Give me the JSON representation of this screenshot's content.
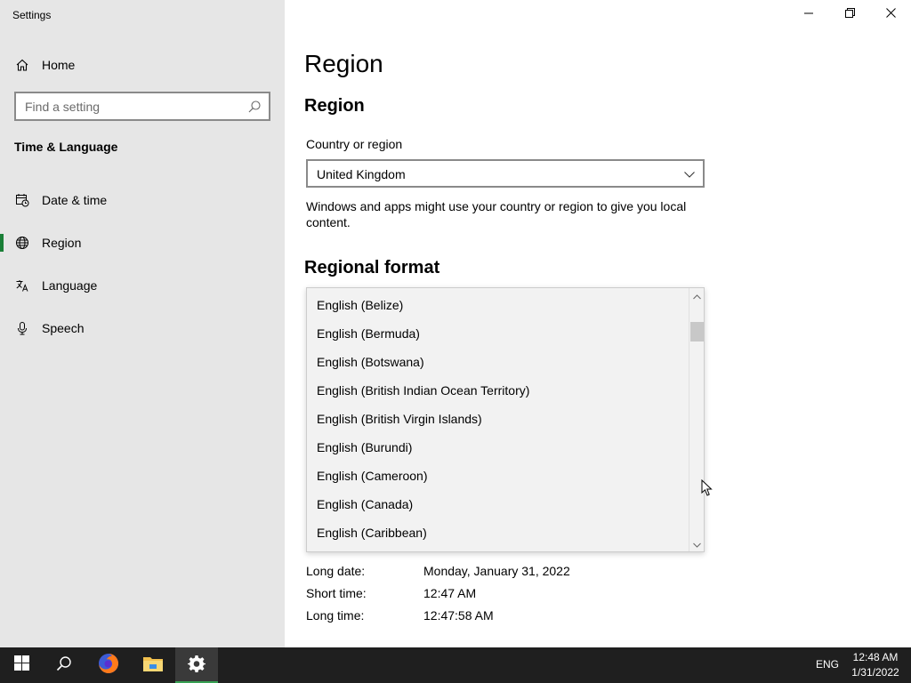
{
  "window": {
    "title": "Settings",
    "minimize_icon": "minimize-icon",
    "restore_icon": "restore-icon",
    "close_icon": "close-icon"
  },
  "sidebar": {
    "home_label": "Home",
    "search_placeholder": "Find a setting",
    "section_heading": "Time & Language",
    "items": [
      {
        "label": "Date & time",
        "icon": "calendar-clock-icon"
      },
      {
        "label": "Region",
        "icon": "globe-icon",
        "selected": true
      },
      {
        "label": "Language",
        "icon": "language-icon"
      },
      {
        "label": "Speech",
        "icon": "microphone-icon"
      }
    ]
  },
  "main": {
    "page_title": "Region",
    "region_heading": "Region",
    "country_label": "Country or region",
    "country_value": "United Kingdom",
    "description": "Windows and apps might use your country or region to give you local content.",
    "regional_format_heading": "Regional format",
    "format_options": [
      "English (Belize)",
      "English (Bermuda)",
      "English (Botswana)",
      "English (British Indian Ocean Territory)",
      "English (British Virgin Islands)",
      "English (Burundi)",
      "English (Cameroon)",
      "English (Canada)",
      "English (Caribbean)"
    ],
    "format_info": [
      {
        "label": "Long date:",
        "value": "Monday, January 31, 2022"
      },
      {
        "label": "Short time:",
        "value": "12:47 AM"
      },
      {
        "label": "Long time:",
        "value": "12:47:58 AM"
      }
    ]
  },
  "taskbar": {
    "input_language": "ENG",
    "time": "12:48 AM",
    "date": "1/31/2022",
    "apps": [
      "start-icon",
      "search-icon",
      "firefox-icon",
      "file-explorer-icon",
      "settings-gear-icon"
    ]
  },
  "colors": {
    "sidebar_bg": "#e6e6e6",
    "accent_green": "#1a7f37",
    "taskbar_bg": "#1f1f1f",
    "list_bg": "#f2f2f2"
  }
}
